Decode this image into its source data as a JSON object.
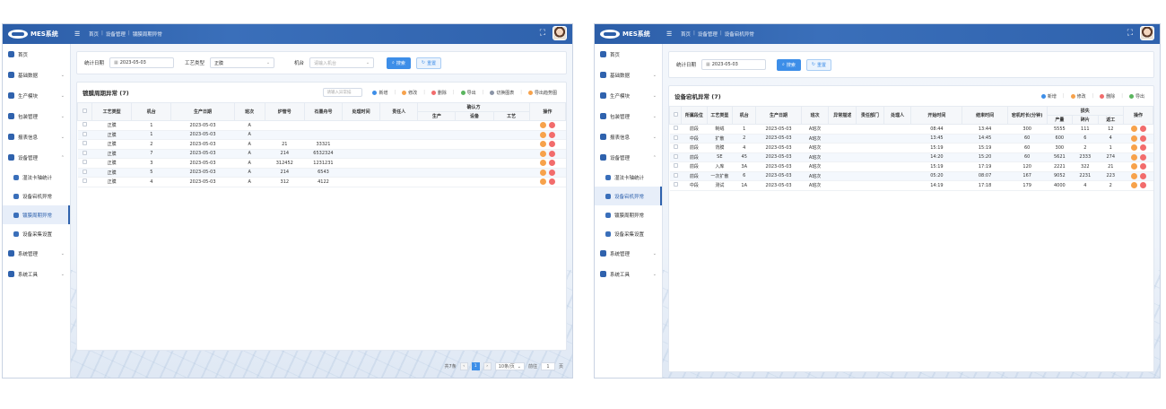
{
  "app": {
    "name": "MES系统",
    "logo_sub": "Solar"
  },
  "win1": {
    "breadcrumbs": [
      "首页",
      "设备管理",
      "镀膜周期异常"
    ],
    "sidebar": [
      {
        "label": "首页",
        "type": "top"
      },
      {
        "label": "基础数据",
        "type": "group"
      },
      {
        "label": "生产模块",
        "type": "group"
      },
      {
        "label": "包装管理",
        "type": "group"
      },
      {
        "label": "报表信息",
        "type": "group"
      },
      {
        "label": "设备管理",
        "type": "group-open"
      },
      {
        "label": "湿法卡轴统计",
        "type": "sub"
      },
      {
        "label": "设备宕机异常",
        "type": "sub"
      },
      {
        "label": "镀膜周期异常",
        "type": "sub-active"
      },
      {
        "label": "设备采集设置",
        "type": "sub"
      },
      {
        "label": "系统管理",
        "type": "group"
      },
      {
        "label": "系统工具",
        "type": "group"
      }
    ],
    "search": {
      "date_label": "统计日期",
      "date_value": "2023-05-03",
      "process_label": "工艺类型",
      "process_value": "正膜",
      "machine_label": "机台",
      "machine_placeholder": "请输入机台",
      "search_btn": "搜索",
      "reset_btn": "重置"
    },
    "panel": {
      "title": "镀膜周期异常 (7)",
      "search_placeholder": "请输入异常描",
      "tools": [
        "新增",
        "修改",
        "删除",
        "导出",
        "切换图表",
        "导出趋势图"
      ]
    },
    "table": {
      "headers": [
        "工艺类型",
        "机台",
        "生产日期",
        "班次",
        "炉管号",
        "石墨舟号",
        "处理时间",
        "责任人",
        "确认方",
        "操作"
      ],
      "sub_headers": [
        "生产",
        "设备",
        "工艺"
      ],
      "rows": [
        [
          "正膜",
          "1",
          "2023-05-03",
          "A",
          "",
          ""
        ],
        [
          "正膜",
          "1",
          "2023-05-03",
          "A",
          "",
          ""
        ],
        [
          "正膜",
          "2",
          "2023-05-03",
          "A",
          "21",
          "33321"
        ],
        [
          "正膜",
          "7",
          "2023-05-03",
          "A",
          "214",
          "6532324"
        ],
        [
          "正膜",
          "3",
          "2023-05-03",
          "A",
          "312452",
          "1231231"
        ],
        [
          "正膜",
          "5",
          "2023-05-03",
          "A",
          "214",
          "6543"
        ],
        [
          "正膜",
          "4",
          "2023-05-03",
          "A",
          "312",
          "4122"
        ]
      ]
    },
    "pager": {
      "total": "共7条",
      "page": "1",
      "size": "10条/页",
      "goto_label": "前往",
      "goto_value": "1",
      "page_unit": "页"
    }
  },
  "win2": {
    "breadcrumbs": [
      "首页",
      "设备管理",
      "设备宕机异常"
    ],
    "sidebar": [
      {
        "label": "首页",
        "type": "top"
      },
      {
        "label": "基础数据",
        "type": "group"
      },
      {
        "label": "生产模块",
        "type": "group"
      },
      {
        "label": "包装管理",
        "type": "group"
      },
      {
        "label": "报表信息",
        "type": "group"
      },
      {
        "label": "设备管理",
        "type": "group-open"
      },
      {
        "label": "湿法卡轴统计",
        "type": "sub"
      },
      {
        "label": "设备宕机异常",
        "type": "sub-active"
      },
      {
        "label": "镀膜周期异常",
        "type": "sub"
      },
      {
        "label": "设备采集设置",
        "type": "sub"
      },
      {
        "label": "系统管理",
        "type": "group"
      },
      {
        "label": "系统工具",
        "type": "group"
      }
    ],
    "search": {
      "date_label": "统计日期",
      "date_value": "2023-05-03",
      "search_btn": "搜索",
      "reset_btn": "重置"
    },
    "panel": {
      "title": "设备宕机异常 (7)",
      "tools": [
        "新增",
        "修改",
        "删除",
        "导出"
      ]
    },
    "table": {
      "headers": [
        "所属段位",
        "工艺类型",
        "机台",
        "生产日期",
        "班次",
        "异常描述",
        "责任部门",
        "处理人",
        "开始时间",
        "结束时间",
        "宕机时长(分钟)",
        "损失",
        "操作"
      ],
      "sub_headers": [
        "产量",
        "碎片",
        "返工"
      ],
      "rows": [
        [
          "前段",
          "制绒",
          "1",
          "2023-05-03",
          "A班次",
          "",
          "",
          "",
          "08:44",
          "13:44",
          "300",
          "5555",
          "111",
          "12"
        ],
        [
          "中段",
          "扩散",
          "2",
          "2023-05-03",
          "A班次",
          "",
          "",
          "",
          "13:45",
          "14:45",
          "60",
          "600",
          "6",
          "4"
        ],
        [
          "前段",
          "背膜",
          "4",
          "2023-05-03",
          "A班次",
          "",
          "",
          "",
          "15:19",
          "15:19",
          "60",
          "300",
          "2",
          "1"
        ],
        [
          "前段",
          "SE",
          "45",
          "2023-05-03",
          "A班次",
          "",
          "",
          "",
          "14:20",
          "15:20",
          "60",
          "5621",
          "2333",
          "274"
        ],
        [
          "前段",
          "入库",
          "3A",
          "2023-05-03",
          "A班次",
          "",
          "",
          "",
          "15:19",
          "17:19",
          "120",
          "2221",
          "322",
          "21"
        ],
        [
          "前段",
          "一次扩散",
          "6",
          "2023-05-03",
          "A班次",
          "",
          "",
          "",
          "05:20",
          "08:07",
          "167",
          "9052",
          "2231",
          "223"
        ],
        [
          "中段",
          "测试",
          "1A",
          "2023-05-03",
          "A班次",
          "",
          "",
          "",
          "14:19",
          "17:18",
          "179",
          "4000",
          "4",
          "2"
        ]
      ]
    }
  },
  "colors": {
    "primary": "#2f62ad",
    "button": "#3d8ee8",
    "edit": "#f7a24b",
    "delete": "#f26c6c"
  }
}
